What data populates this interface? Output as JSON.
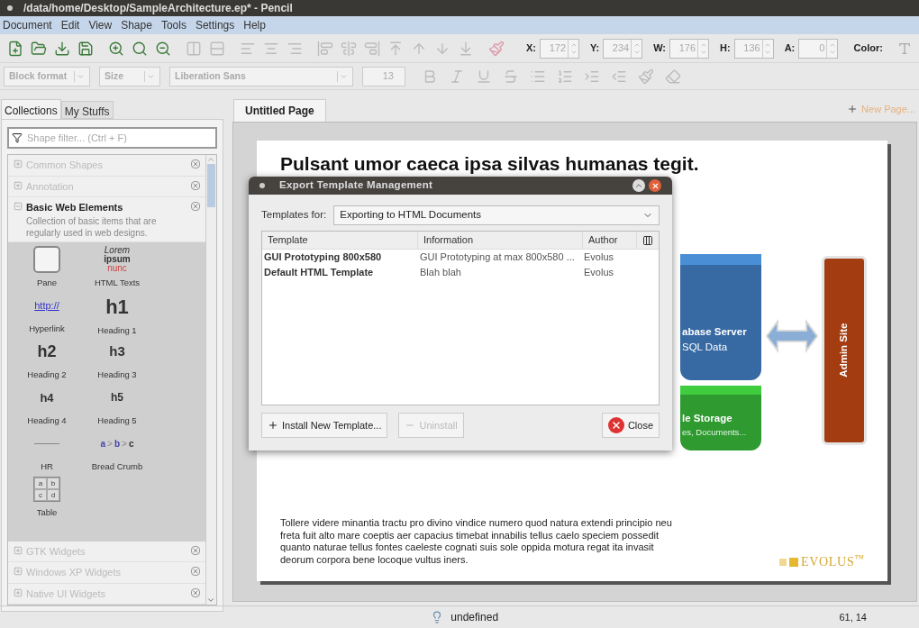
{
  "window": {
    "title": "/data/home/Desktop/SampleArchitecture.ep* - Pencil"
  },
  "menu": [
    {
      "label": "Document"
    },
    {
      "label": "Edit"
    },
    {
      "label": "View"
    },
    {
      "label": "Shape"
    },
    {
      "label": "Tools"
    },
    {
      "label": "Settings"
    },
    {
      "label": "Help"
    }
  ],
  "geometry": [
    {
      "label": "X:",
      "value": "172"
    },
    {
      "label": "Y:",
      "value": "234"
    },
    {
      "label": "W:",
      "value": "176"
    },
    {
      "label": "H:",
      "value": "136"
    },
    {
      "label": "A:",
      "value": "0"
    }
  ],
  "color_label": "Color:",
  "format_bar": {
    "block_format": "Block format",
    "size": "Size",
    "font": "Liberation Sans",
    "font_size": "13"
  },
  "sidebar": {
    "tabs": [
      {
        "label": "Collections",
        "selected": true
      },
      {
        "label": "My Stuffs",
        "selected": false
      }
    ],
    "filter": {
      "placeholder": "Shape filter... (Ctrl + F)"
    },
    "collections": [
      {
        "name": "Common Shapes",
        "expanded": false
      },
      {
        "name": "Annotation",
        "expanded": false
      },
      {
        "name": "Basic Web Elements",
        "expanded": true,
        "description": "Collection of basic items that are regularly used in web designs.",
        "shapes": [
          {
            "kind": "pane",
            "label": "Pane"
          },
          {
            "kind": "link",
            "label": "Hyperlink",
            "preview": [
              "http://"
            ]
          },
          {
            "kind": "h2",
            "label": "Heading 2",
            "preview": [
              "h2"
            ]
          },
          {
            "kind": "h4",
            "label": "Heading 4",
            "preview": [
              "h4"
            ]
          },
          {
            "kind": "hr",
            "label": "HR"
          },
          {
            "kind": "table",
            "label": "Table",
            "preview": [
              "a",
              "b",
              "c",
              "d"
            ]
          },
          {
            "kind": "texts",
            "label": "HTML Texts",
            "preview": [
              "Lorem",
              "ipsum",
              "nunc"
            ]
          },
          {
            "kind": "h1",
            "label": "Heading 1",
            "preview": [
              "h1"
            ]
          },
          {
            "kind": "h3",
            "label": "Heading 3",
            "preview": [
              "h3"
            ]
          },
          {
            "kind": "h5",
            "label": "Heading 5",
            "preview": [
              "h5"
            ]
          },
          {
            "kind": "breadcrumb",
            "label": "Bread Crumb",
            "preview": [
              "a",
              ">",
              "b",
              ">",
              "c"
            ]
          }
        ]
      },
      {
        "name": "GTK Widgets",
        "expanded": false
      },
      {
        "name": "Windows XP Widgets",
        "expanded": false
      },
      {
        "name": "Native UI Widgets",
        "expanded": false
      }
    ]
  },
  "page_tabs": [
    {
      "label": "Untitled Page",
      "selected": true
    }
  ],
  "new_page": "New Page...",
  "canvas": {
    "heading": "Pulsant umor caeca ipsa silvas humanas tegit.",
    "diagram": {
      "server_title": "abase Server",
      "server_sub": "SQL Data",
      "storage_title": "le Storage",
      "storage_sub": "es, Documents...",
      "admin": "Admin Site"
    },
    "paragraph": "Tollere videre minantia tractu pro divino vindice numero quod natura extendi principio neu freta fuit alto mare coeptis aer capacius timebat innabilis tellus caelo speciem possedit quanto naturae tellus fontes caeleste cognati suis sole oppida motura regat ita invasit deorum corpora bene locoque vultus iners.",
    "logo": "EVOLUS$^{™}$"
  },
  "dialog": {
    "title": "Export Template Management",
    "templates_for_label": "Templates for:",
    "templates_for_value": "Exporting to HTML Documents",
    "columns": [
      "Template",
      "Information",
      "Author"
    ],
    "rows": [
      {
        "template": "GUI Prototyping 800x580",
        "information": "GUI Prototyping at max 800x580 ...",
        "author": "Evolus"
      },
      {
        "template": "Default HTML Template",
        "information": "Blah blah",
        "author": "Evolus"
      }
    ],
    "buttons": [
      {
        "kind": "install",
        "label": "Install New Template...",
        "disabled": false
      },
      {
        "kind": "uninstall",
        "label": "Uninstall",
        "disabled": true
      },
      {
        "kind": "close",
        "label": "Close",
        "disabled": false
      }
    ]
  },
  "status_bar": {
    "message": "undefined",
    "position": "61, 14"
  }
}
